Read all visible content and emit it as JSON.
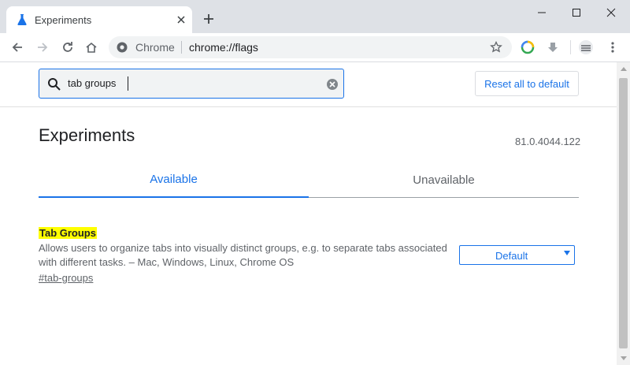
{
  "window": {
    "tab_title": "Experiments",
    "tab_icon": "flask-icon"
  },
  "toolbar": {
    "omnibox_scheme": "Chrome",
    "omnibox_url": "chrome://flags"
  },
  "search": {
    "value": "tab groups"
  },
  "header": {
    "reset_label": "Reset all to default"
  },
  "page": {
    "title": "Experiments",
    "version": "81.0.4044.122"
  },
  "tabs": [
    {
      "label": "Available",
      "active": true
    },
    {
      "label": "Unavailable",
      "active": false
    }
  ],
  "flag": {
    "name": "Tab Groups",
    "description": "Allows users to organize tabs into visually distinct groups, e.g. to separate tabs associated with different tasks. – Mac, Windows, Linux, Chrome OS",
    "link": "#tab-groups",
    "selected": "Default"
  },
  "colors": {
    "accent": "#1a73e8",
    "highlight": "#ffff00",
    "tabstrip": "#dee1e6"
  }
}
